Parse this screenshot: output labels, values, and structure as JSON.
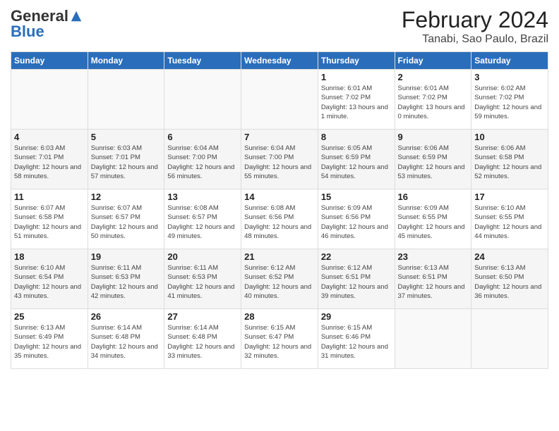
{
  "logo": {
    "general": "General",
    "blue": "Blue"
  },
  "title": {
    "month_year": "February 2024",
    "location": "Tanabi, Sao Paulo, Brazil"
  },
  "days_header": [
    "Sunday",
    "Monday",
    "Tuesday",
    "Wednesday",
    "Thursday",
    "Friday",
    "Saturday"
  ],
  "weeks": [
    {
      "days": [
        {
          "num": "",
          "empty": true
        },
        {
          "num": "",
          "empty": true
        },
        {
          "num": "",
          "empty": true
        },
        {
          "num": "",
          "empty": true
        },
        {
          "num": "1",
          "sunrise": "6:01 AM",
          "sunset": "7:02 PM",
          "daylight": "13 hours and 1 minute."
        },
        {
          "num": "2",
          "sunrise": "6:01 AM",
          "sunset": "7:02 PM",
          "daylight": "13 hours and 0 minutes."
        },
        {
          "num": "3",
          "sunrise": "6:02 AM",
          "sunset": "7:02 PM",
          "daylight": "12 hours and 59 minutes."
        }
      ]
    },
    {
      "shaded": true,
      "days": [
        {
          "num": "4",
          "sunrise": "6:03 AM",
          "sunset": "7:01 PM",
          "daylight": "12 hours and 58 minutes."
        },
        {
          "num": "5",
          "sunrise": "6:03 AM",
          "sunset": "7:01 PM",
          "daylight": "12 hours and 57 minutes."
        },
        {
          "num": "6",
          "sunrise": "6:04 AM",
          "sunset": "7:00 PM",
          "daylight": "12 hours and 56 minutes."
        },
        {
          "num": "7",
          "sunrise": "6:04 AM",
          "sunset": "7:00 PM",
          "daylight": "12 hours and 55 minutes."
        },
        {
          "num": "8",
          "sunrise": "6:05 AM",
          "sunset": "6:59 PM",
          "daylight": "12 hours and 54 minutes."
        },
        {
          "num": "9",
          "sunrise": "6:06 AM",
          "sunset": "6:59 PM",
          "daylight": "12 hours and 53 minutes."
        },
        {
          "num": "10",
          "sunrise": "6:06 AM",
          "sunset": "6:58 PM",
          "daylight": "12 hours and 52 minutes."
        }
      ]
    },
    {
      "days": [
        {
          "num": "11",
          "sunrise": "6:07 AM",
          "sunset": "6:58 PM",
          "daylight": "12 hours and 51 minutes."
        },
        {
          "num": "12",
          "sunrise": "6:07 AM",
          "sunset": "6:57 PM",
          "daylight": "12 hours and 50 minutes."
        },
        {
          "num": "13",
          "sunrise": "6:08 AM",
          "sunset": "6:57 PM",
          "daylight": "12 hours and 49 minutes."
        },
        {
          "num": "14",
          "sunrise": "6:08 AM",
          "sunset": "6:56 PM",
          "daylight": "12 hours and 48 minutes."
        },
        {
          "num": "15",
          "sunrise": "6:09 AM",
          "sunset": "6:56 PM",
          "daylight": "12 hours and 46 minutes."
        },
        {
          "num": "16",
          "sunrise": "6:09 AM",
          "sunset": "6:55 PM",
          "daylight": "12 hours and 45 minutes."
        },
        {
          "num": "17",
          "sunrise": "6:10 AM",
          "sunset": "6:55 PM",
          "daylight": "12 hours and 44 minutes."
        }
      ]
    },
    {
      "shaded": true,
      "days": [
        {
          "num": "18",
          "sunrise": "6:10 AM",
          "sunset": "6:54 PM",
          "daylight": "12 hours and 43 minutes."
        },
        {
          "num": "19",
          "sunrise": "6:11 AM",
          "sunset": "6:53 PM",
          "daylight": "12 hours and 42 minutes."
        },
        {
          "num": "20",
          "sunrise": "6:11 AM",
          "sunset": "6:53 PM",
          "daylight": "12 hours and 41 minutes."
        },
        {
          "num": "21",
          "sunrise": "6:12 AM",
          "sunset": "6:52 PM",
          "daylight": "12 hours and 40 minutes."
        },
        {
          "num": "22",
          "sunrise": "6:12 AM",
          "sunset": "6:51 PM",
          "daylight": "12 hours and 39 minutes."
        },
        {
          "num": "23",
          "sunrise": "6:13 AM",
          "sunset": "6:51 PM",
          "daylight": "12 hours and 37 minutes."
        },
        {
          "num": "24",
          "sunrise": "6:13 AM",
          "sunset": "6:50 PM",
          "daylight": "12 hours and 36 minutes."
        }
      ]
    },
    {
      "days": [
        {
          "num": "25",
          "sunrise": "6:13 AM",
          "sunset": "6:49 PM",
          "daylight": "12 hours and 35 minutes."
        },
        {
          "num": "26",
          "sunrise": "6:14 AM",
          "sunset": "6:48 PM",
          "daylight": "12 hours and 34 minutes."
        },
        {
          "num": "27",
          "sunrise": "6:14 AM",
          "sunset": "6:48 PM",
          "daylight": "12 hours and 33 minutes."
        },
        {
          "num": "28",
          "sunrise": "6:15 AM",
          "sunset": "6:47 PM",
          "daylight": "12 hours and 32 minutes."
        },
        {
          "num": "29",
          "sunrise": "6:15 AM",
          "sunset": "6:46 PM",
          "daylight": "12 hours and 31 minutes."
        },
        {
          "num": "",
          "empty": true
        },
        {
          "num": "",
          "empty": true
        }
      ]
    }
  ]
}
